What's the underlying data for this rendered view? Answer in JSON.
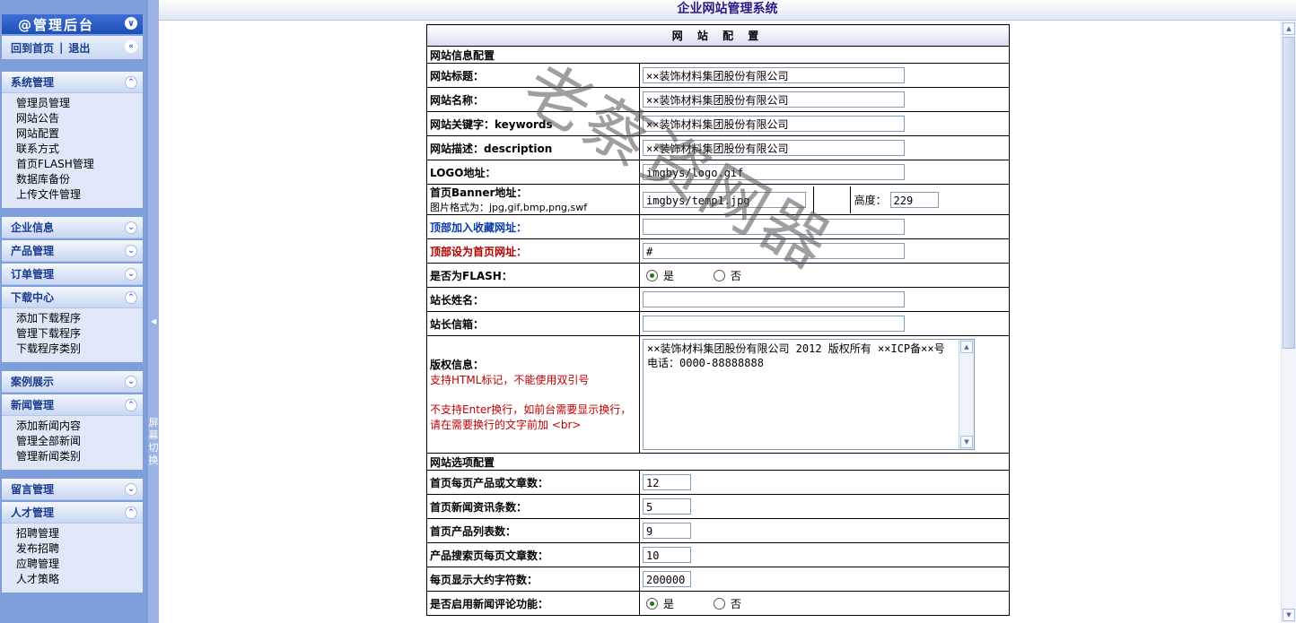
{
  "topbar": {
    "title": "企业网站管理系统"
  },
  "sidebar": {
    "header": "@管理后台",
    "home_link": "回到首页",
    "separator": "|",
    "logout_link": "退出",
    "groups": [
      {
        "title": "系统管理",
        "expanded": true,
        "items": [
          "管理员管理",
          "网站公告",
          "网站配置",
          "联系方式",
          "首页FLASH管理",
          "数据库备份",
          "上传文件管理"
        ]
      },
      {
        "title": "企业信息",
        "expanded": false,
        "items": []
      },
      {
        "title": "产品管理",
        "expanded": false,
        "items": []
      },
      {
        "title": "订单管理",
        "expanded": false,
        "items": []
      },
      {
        "title": "下载中心",
        "expanded": true,
        "items": [
          "添加下载程序",
          "管理下载程序",
          "下载程序类别"
        ]
      },
      {
        "title": "案例展示",
        "expanded": false,
        "items": []
      },
      {
        "title": "新闻管理",
        "expanded": true,
        "items": [
          "添加新闻内容",
          "管理全部新闻",
          "管理新闻类别"
        ]
      },
      {
        "title": "留言管理",
        "expanded": false,
        "items": []
      },
      {
        "title": "人才管理",
        "expanded": true,
        "items": [
          "招聘管理",
          "发布招聘",
          "应聘管理",
          "人才策略"
        ]
      }
    ],
    "splitter_text": "屏幕切换"
  },
  "config": {
    "title": "网 站 配 置",
    "section_info": "网站信息配置",
    "site_title_label": "网站标题：",
    "site_title_value": "××装饰材料集团股份有限公司",
    "site_name_label": "网站名称：",
    "site_name_value": "××装饰材料集团股份有限公司",
    "keywords_label": "网站关键字：keywords",
    "keywords_value": "××装饰材料集团股份有限公司",
    "desc_label": "网站描述：description",
    "desc_value": "××装饰材料集团股份有限公司",
    "logo_label": "LOGO地址：",
    "logo_value": "imgbys/logo.gif",
    "banner_label": "首页Banner地址：",
    "banner_hint": "图片格式为：jpg,gif,bmp,png,swf",
    "banner_value": "imgbys/temp1.jpg",
    "height_label": "高度：",
    "height_value": "229",
    "fav_label": "顶部加入收藏网址：",
    "fav_value": "",
    "homepage_label": "顶部设为首页网址：",
    "homepage_value": "#",
    "flash_label": "是否为FLASH：",
    "yes": "是",
    "no": "否",
    "owner_name_label": "站长姓名：",
    "owner_name_value": "",
    "owner_mail_label": "站长信箱：",
    "owner_mail_value": "",
    "copyright_label": "版权信息：",
    "copyright_note1": "支持HTML标记，不能使用双引号",
    "copyright_note2": "不支持Enter换行，如前台需要显示换行，请在需要换行的文字前加 <br>",
    "copyright_value": "××装饰材料集团股份有限公司  2012  版权所有 ××ICP备××号 电话：0000-88888888",
    "section_options": "网站选项配置",
    "opt1_label": "首页每页产品或文章数：",
    "opt1_value": "12",
    "opt2_label": "首页新闻资讯条数：",
    "opt2_value": "5",
    "opt3_label": "首页产品列表数：",
    "opt3_value": "9",
    "opt4_label": "产品搜索页每页文章数：",
    "opt4_value": "10",
    "opt5_label": "每页显示大约字符数：",
    "opt5_value": "200000",
    "opt6_label": "是否启用新闻评论功能："
  },
  "watermark": "老蔡资网器"
}
